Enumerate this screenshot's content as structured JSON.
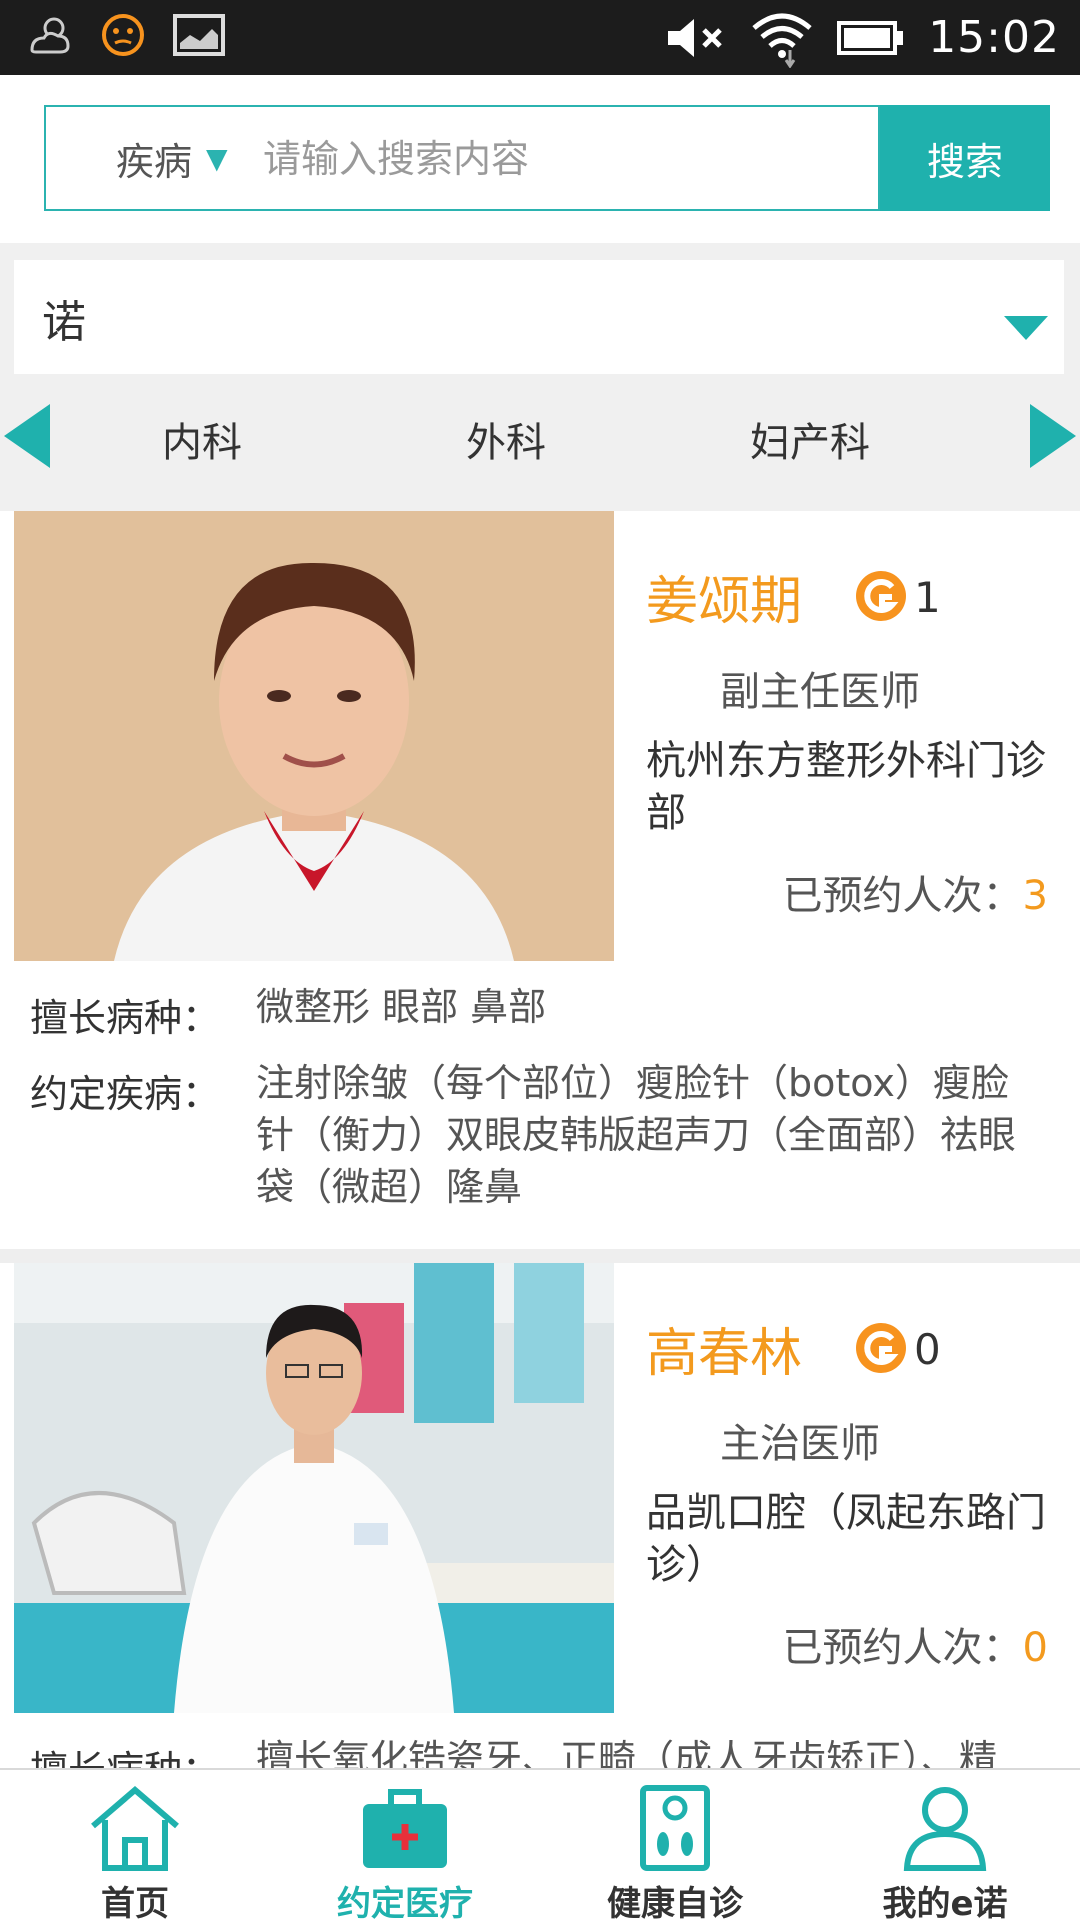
{
  "status_bar": {
    "time": "15:02",
    "left_icons": [
      "weather-icon",
      "notification-face-icon",
      "image-icon"
    ],
    "right_icons": [
      "mute-icon",
      "wifi-icon",
      "battery-icon"
    ]
  },
  "search": {
    "type_label": "疾病",
    "placeholder": "请输入搜索内容",
    "button_label": "搜索"
  },
  "filter": {
    "selected": "诺"
  },
  "departments": [
    "内科",
    "外科",
    "妇产科"
  ],
  "doctors": [
    {
      "name": "姜颂期",
      "coins": "1",
      "title": "副主任医师",
      "hospital": "杭州东方整形外科门诊部",
      "booked_label": "已预约人次：",
      "booked_count": "3",
      "specialty_label": "擅长病种：",
      "specialty": "微整形 眼部 鼻部",
      "treatments_label": "约定疾病：",
      "treatments": "注射除皱（每个部位）瘦脸针（botox）瘦脸针（衡力）双眼皮韩版超声刀（全面部）祛眼袋（微超）隆鼻"
    },
    {
      "name": "高春林",
      "coins": "0",
      "title": "主治医师",
      "hospital": "品凯口腔（凤起东路门诊）",
      "booked_label": "已预约人次：",
      "booked_count": "0",
      "specialty_label": "擅长病种：",
      "specialty": "擅长氧化锆瓷牙、正畸（成人牙齿矫正）、精"
    }
  ],
  "bottom_nav": [
    {
      "label": "首页",
      "icon": "home-icon"
    },
    {
      "label": "约定医疗",
      "icon": "medical-kit-icon",
      "active": true
    },
    {
      "label": "健康自诊",
      "icon": "scale-icon"
    },
    {
      "label": "我的e诺",
      "icon": "user-icon"
    }
  ],
  "colors": {
    "accent": "#1fb1ad",
    "highlight": "#f39a1e",
    "status_bar": "#1c1c1c"
  }
}
